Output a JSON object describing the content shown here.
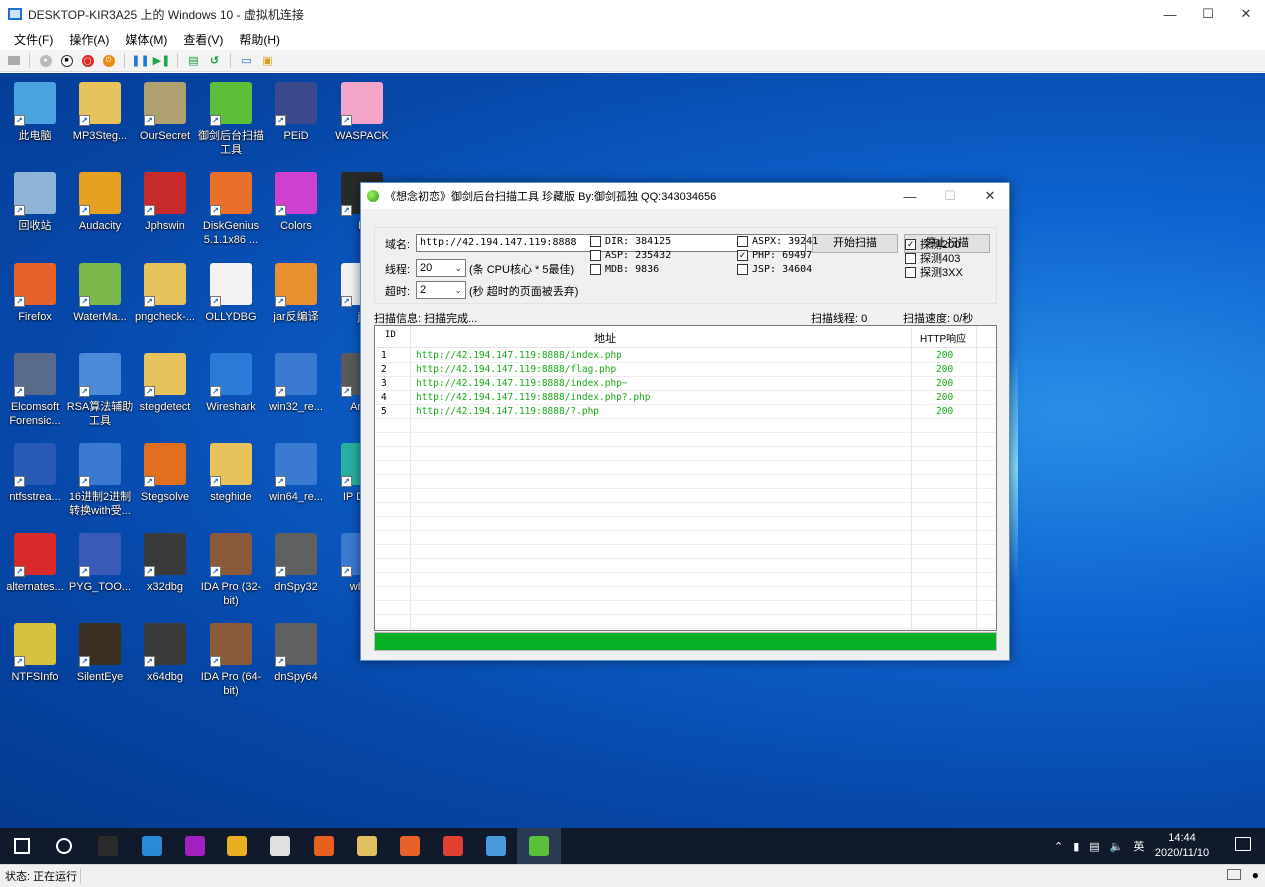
{
  "vm": {
    "title": "DESKTOP-KIR3A25 上的 Windows 10 - 虚拟机连接",
    "menu": [
      "文件(F)",
      "操作(A)",
      "媒体(M)",
      "查看(V)",
      "帮助(H)"
    ],
    "status": "状态: 正在运行"
  },
  "desktop": {
    "icons": [
      {
        "label": "此电脑",
        "icon": "computer-icon",
        "color": "#4aa3e0"
      },
      {
        "label": "MP3Steg...",
        "icon": "folder-icon",
        "color": "#e8c25a"
      },
      {
        "label": "OurSecret",
        "icon": "lock-icon",
        "color": "#b0a070"
      },
      {
        "label": "御剑后台扫描工具",
        "icon": "arrow-icon",
        "color": "#5cbf3a"
      },
      {
        "label": "PEiD",
        "icon": "peid-icon",
        "color": "#3a4a8a"
      },
      {
        "label": "WASPACK",
        "icon": "sakura-icon",
        "color": "#f2a6c8"
      },
      {
        "label": "回收站",
        "icon": "recycle-bin-icon",
        "color": "#8fb4d8"
      },
      {
        "label": "Audacity",
        "icon": "headphones-icon",
        "color": "#e8a020"
      },
      {
        "label": "Jphswin",
        "icon": "noise-image-icon",
        "color": "#c82a2a"
      },
      {
        "label": "DiskGenius 5.1.1x86 ...",
        "icon": "diskgenius-icon",
        "color": "#e8702a"
      },
      {
        "label": "Colors",
        "icon": "rainbow-icon",
        "color": "#d040d0"
      },
      {
        "label": "Firefox",
        "icon": "firefox-icon",
        "color": "#e8602a"
      },
      {
        "label": "WaterMa...",
        "icon": "watermark-icon",
        "color": "#7ab84a"
      },
      {
        "label": "pngcheck-...",
        "icon": "folder-icon",
        "color": "#e8c25a"
      },
      {
        "label": "OLLYDBG",
        "icon": "file-icon",
        "color": "#f2f2f2"
      },
      {
        "label": "jar反编译",
        "icon": "java-cup-icon",
        "color": "#e89030"
      },
      {
        "label": "Elcomsoft Forensic...",
        "icon": "drive-icon",
        "color": "#5a6a8a"
      },
      {
        "label": "RSA算法辅助工具",
        "icon": "shield-icon",
        "color": "#4a8ad8"
      },
      {
        "label": "stegdetect",
        "icon": "folder-icon",
        "color": "#e8c25a"
      },
      {
        "label": "Wireshark",
        "icon": "shark-fin-icon",
        "color": "#2a7ad8"
      },
      {
        "label": "win32_re...",
        "icon": "window-icon",
        "color": "#3a7ad0"
      },
      {
        "label": "ntfsstrea...",
        "icon": "nsf-icon",
        "color": "#2a5ab8"
      },
      {
        "label": "16进制2进制转换with受...",
        "icon": "window-icon",
        "color": "#3a7ad0"
      },
      {
        "label": "Stegsolve",
        "icon": "java-icon",
        "color": "#e07020"
      },
      {
        "label": "steghide",
        "icon": "folder-icon",
        "color": "#e8c25a"
      },
      {
        "label": "win64_re...",
        "icon": "window-icon",
        "color": "#3a7ad0"
      },
      {
        "label": "alternates...",
        "icon": "s-file-icon",
        "color": "#d82a2a"
      },
      {
        "label": "PYG_TOO...",
        "icon": "shield-icon",
        "color": "#3a5ab8"
      },
      {
        "label": "x32dbg",
        "icon": "bug-icon",
        "color": "#3a3a3a"
      },
      {
        "label": "IDA Pro (32-bit)",
        "icon": "ida-portrait-icon",
        "color": "#8a5a3a"
      },
      {
        "label": "dnSpy32",
        "icon": "stacked-boxes-icon",
        "color": "#606060"
      },
      {
        "label": "NTFSInfo",
        "icon": "magnifier-folder-icon",
        "color": "#d8c040"
      },
      {
        "label": "SilentEye",
        "icon": "hooded-figure-icon",
        "color": "#3a3020"
      },
      {
        "label": "x64dbg",
        "icon": "bug-icon",
        "color": "#3a3a3a"
      },
      {
        "label": "IDA Pro (64-bit)",
        "icon": "ida-portrait-icon",
        "color": "#8a5a3a"
      },
      {
        "label": "dnSpy64",
        "icon": "stacked-boxes-icon",
        "color": "#606060"
      },
      {
        "label": "D",
        "icon": "dark-app-icon",
        "color": "#2a2a2a"
      },
      {
        "label": "ja",
        "icon": "file-icon",
        "color": "#f2f2f2"
      },
      {
        "label": "AntS",
        "icon": "gear-icon",
        "color": "#5a5a5a"
      },
      {
        "label": "IP Desk",
        "icon": "cube-icon",
        "color": "#2ab0a0"
      },
      {
        "label": "wbSt",
        "icon": "window-icon",
        "color": "#3a7ad0"
      }
    ]
  },
  "scanner": {
    "title": "《想念初恋》御剑后台扫描工具 珍藏版 By:御剑孤独 QQ:343034656",
    "domain_label": "域名:",
    "domain_value": "http://42.194.147.119:8888",
    "threads_label": "线程:",
    "threads_value": "20",
    "threads_hint": "(条 CPU核心 * 5最佳)",
    "timeout_label": "超时:",
    "timeout_value": "2",
    "timeout_hint": "(秒 超时的页面被丢弃)",
    "start_button": "开始扫描",
    "stop_button": "停止扫描",
    "checks": [
      {
        "label": "DIR: 384125",
        "checked": false
      },
      {
        "label": "ASP: 235432",
        "checked": false
      },
      {
        "label": "MDB: 9836",
        "checked": false
      },
      {
        "label": "ASPX: 39241",
        "checked": false
      },
      {
        "label": "PHP: 69497",
        "checked": true
      },
      {
        "label": "JSP: 34604",
        "checked": false
      },
      {
        "label": "探测200",
        "checked": true
      },
      {
        "label": "探测403",
        "checked": false
      },
      {
        "label": "探测3XX",
        "checked": false
      }
    ],
    "scan_info": "扫描信息: 扫描完成...",
    "scan_threads": "扫描线程: 0",
    "scan_speed": "扫描速度: 0/秒",
    "columns": {
      "id": "ID",
      "url": "地址",
      "code": "HTTP响应"
    },
    "results": [
      {
        "id": "1",
        "url": "http://42.194.147.119:8888/index.php",
        "code": "200"
      },
      {
        "id": "2",
        "url": "http://42.194.147.119:8888/flag.php",
        "code": "200"
      },
      {
        "id": "3",
        "url": "http://42.194.147.119:8888/index.php~",
        "code": "200"
      },
      {
        "id": "4",
        "url": "http://42.194.147.119:8888/index.php?.php",
        "code": "200"
      },
      {
        "id": "5",
        "url": "http://42.194.147.119:8888/?.php",
        "code": "200"
      }
    ],
    "progress": 1.0
  },
  "taskbar": {
    "items": [
      {
        "icon": "windows-start-icon",
        "color": "#ffffff"
      },
      {
        "icon": "search-icon",
        "color": "#ffffff"
      },
      {
        "icon": "terminal-icon",
        "color": "#2a2a2a"
      },
      {
        "icon": "vscode-icon",
        "color": "#2a8ad8"
      },
      {
        "icon": "hex-editor-icon",
        "color": "#a020c0"
      },
      {
        "icon": "eraser-icon",
        "color": "#e8b020"
      },
      {
        "icon": "qr-code-icon",
        "color": "#e0e0e0"
      },
      {
        "icon": "sublime-icon",
        "color": "#e86020"
      },
      {
        "icon": "person-icon",
        "color": "#e0c060"
      },
      {
        "icon": "firefox-icon",
        "color": "#e8602a"
      },
      {
        "icon": "chrome-icon",
        "color": "#e04030"
      },
      {
        "icon": "laptop-icon",
        "color": "#4a9ae0"
      },
      {
        "icon": "arrow-icon",
        "color": "#5cbf3a"
      }
    ],
    "ime": "英",
    "time": "14:44",
    "date": "2020/11/10"
  }
}
